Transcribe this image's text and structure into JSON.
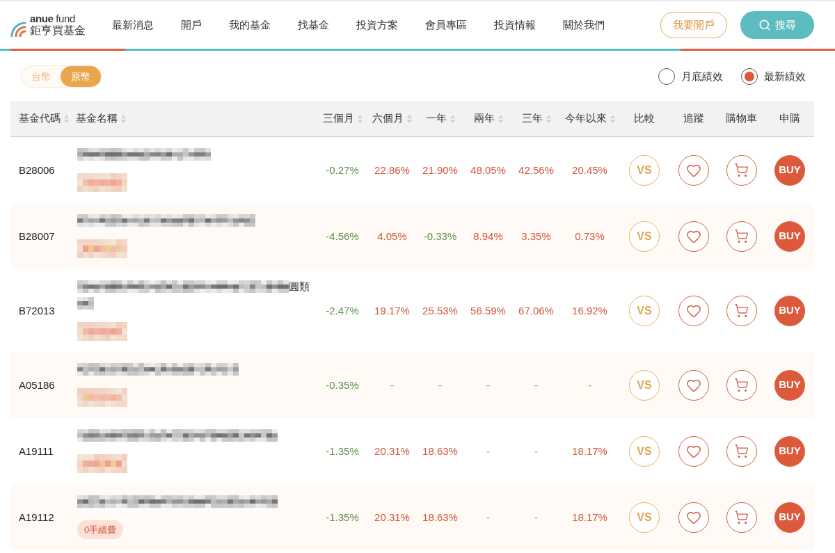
{
  "header": {
    "logo": {
      "brand": "**anue** fund",
      "name": "鉅亨買基金"
    },
    "nav": [
      "最新消息",
      "開戶",
      "我的基金",
      "找基金",
      "投資方案",
      "會員專區",
      "投資情報",
      "關於我們"
    ],
    "open_account_button": "我要開戶",
    "search_button": "搜尋"
  },
  "currency_toggle": [
    {
      "label": "台幣",
      "selected": false
    },
    {
      "label": "原幣",
      "selected": true
    }
  ],
  "performance_mode": [
    {
      "label": "月底績效",
      "selected": false
    },
    {
      "label": "最新績效",
      "selected": true
    }
  ],
  "table": {
    "columns": [
      {
        "label": "基金代碼",
        "sortable": true
      },
      {
        "label": "基金名稱",
        "sortable": true
      },
      {
        "label": "三個月",
        "sortable": true
      },
      {
        "label": "六個月",
        "sortable": true
      },
      {
        "label": "一年",
        "sortable": true
      },
      {
        "label": "兩年",
        "sortable": true
      },
      {
        "label": "三年",
        "sortable": true
      },
      {
        "label": "今年以來",
        "sortable": true
      },
      {
        "label": "比較",
        "sortable": false
      },
      {
        "label": "追蹤",
        "sortable": false
      },
      {
        "label": "購物車",
        "sortable": false
      },
      {
        "label": "申購",
        "sortable": false
      }
    ],
    "rows": [
      {
        "code": "B28006",
        "name": {
          "redacted": true
        },
        "tag": {
          "redacted": true
        },
        "returns": [
          {
            "value": "-0.27%",
            "color": "#5e8f4f"
          },
          {
            "value": "22.86%",
            "color": "#d2583a"
          },
          {
            "value": "21.90%",
            "color": "#d2583a"
          },
          {
            "value": "48.05%",
            "color": "#d2583a"
          },
          {
            "value": "42.56%",
            "color": "#d2583a"
          },
          {
            "value": "20.45%",
            "color": "#d2583a"
          }
        ],
        "compare": "VS",
        "buy": "BUY"
      },
      {
        "code": "B28007",
        "name": {
          "redacted": true
        },
        "tag": {
          "redacted": true
        },
        "returns": [
          {
            "value": "-4.56%",
            "color": "#5e8f4f"
          },
          {
            "value": "4.05%",
            "color": "#d2583a"
          },
          {
            "value": "-0.33%",
            "color": "#5e8f4f"
          },
          {
            "value": "8.94%",
            "color": "#d2583a"
          },
          {
            "value": "3.35%",
            "color": "#d2583a"
          },
          {
            "value": "0.73%",
            "color": "#d2583a"
          }
        ],
        "compare": "VS",
        "buy": "BUY"
      },
      {
        "code": "B72013",
        "name": {
          "redacted": true,
          "suffix": "圓類"
        },
        "tag": {
          "redacted": true
        },
        "returns": [
          {
            "value": "-2.47%",
            "color": "#5e8f4f"
          },
          {
            "value": "19.17%",
            "color": "#d2583a"
          },
          {
            "value": "25.53%",
            "color": "#d2583a"
          },
          {
            "value": "56.59%",
            "color": "#d2583a"
          },
          {
            "value": "67.06%",
            "color": "#d2583a"
          },
          {
            "value": "16.92%",
            "color": "#d2583a"
          }
        ],
        "compare": "VS",
        "buy": "BUY"
      },
      {
        "code": "A05186",
        "name": {
          "redacted": true
        },
        "tag": {
          "redacted": true
        },
        "returns": [
          {
            "value": "-0.35%",
            "color": "#5e8f4f"
          },
          {
            "value": "-",
            "color": "#7ea66c"
          },
          {
            "value": "-",
            "color": "#7ea66c"
          },
          {
            "value": "-",
            "color": "#7ea66c"
          },
          {
            "value": "-",
            "color": "#7ea66c"
          },
          {
            "value": "-",
            "color": "#7ea66c"
          }
        ],
        "compare": "VS",
        "buy": "BUY"
      },
      {
        "code": "A19111",
        "name": {
          "redacted": true
        },
        "tag": {
          "redacted": true
        },
        "returns": [
          {
            "value": "-1.35%",
            "color": "#5e8f4f"
          },
          {
            "value": "20.31%",
            "color": "#d2583a"
          },
          {
            "value": "18.63%",
            "color": "#d2583a"
          },
          {
            "value": "-",
            "color": "#7ea66c"
          },
          {
            "value": "-",
            "color": "#7ea66c"
          },
          {
            "value": "18.17%",
            "color": "#d2583a"
          }
        ],
        "compare": "VS",
        "buy": "BUY"
      },
      {
        "code": "A19112",
        "name": {
          "redacted": true
        },
        "tag": {
          "redacted": false,
          "text": "0手續費"
        },
        "returns": [
          {
            "value": "-1.35%",
            "color": "#5e8f4f"
          },
          {
            "value": "20.31%",
            "color": "#d2583a"
          },
          {
            "value": "18.63%",
            "color": "#d2583a"
          },
          {
            "value": "-",
            "color": "#7ea66c"
          },
          {
            "value": "-",
            "color": "#7ea66c"
          },
          {
            "value": "18.17%",
            "color": "#d2583a"
          }
        ],
        "compare": "VS",
        "buy": "BUY"
      }
    ]
  }
}
